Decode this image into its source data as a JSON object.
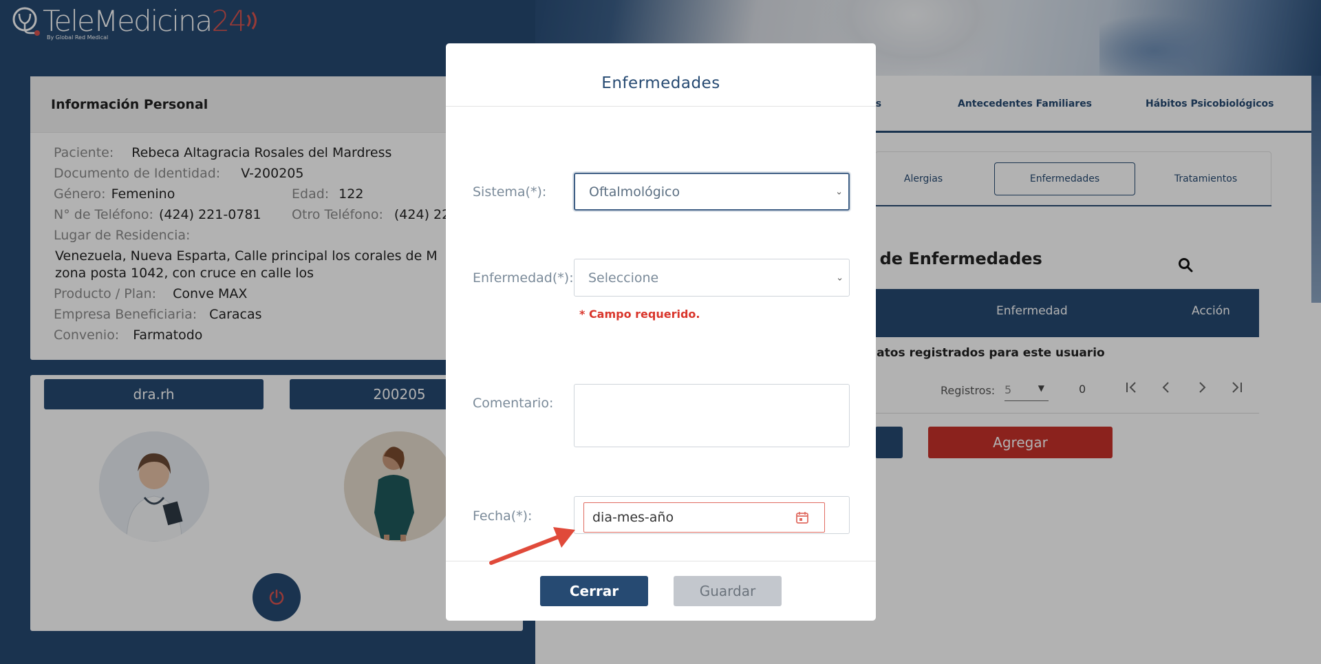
{
  "app": {
    "logo_text": "TeleMedicina",
    "logo_number": "24",
    "logo_byline": "By Global Red Medical"
  },
  "personal_info": {
    "title": "Información Personal",
    "patient_label": "Paciente:",
    "patient_value": "Rebeca Altagracia Rosales del Mardress",
    "id_label": "Documento de Identidad:",
    "id_value": "V-200205",
    "gender_label": "Género:",
    "gender_value": "Femenino",
    "age_label": "Edad:",
    "age_value": "122",
    "phone_label": "N° de Teléfono:",
    "phone_value": "(424) 221-0781",
    "other_phone_label": "Otro Teléfono:",
    "other_phone_value": "(424) 22",
    "residence_label": "Lugar de Residencia:",
    "residence_line1": "Venezuela, Nueva Esparta, Calle principal los corales de M",
    "residence_line2": "zona posta 1042, con cruce en calle los",
    "plan_label": "Producto / Plan:",
    "plan_value": "Conve MAX",
    "company_label": "Empresa Beneficiaria:",
    "company_value": "Caracas",
    "agreement_label": "Convenio:",
    "agreement_value": "Farmatodo"
  },
  "users": {
    "doctor_name": "dra.rh",
    "patient_id": "200205"
  },
  "right_panel": {
    "tabs": [
      "gicos",
      "Antecedentes Familiares",
      "Hábitos Psicobiológicos"
    ],
    "subtabs": [
      "Alergias",
      "Enfermedades",
      "Tratamientos"
    ],
    "active_subtab": "Enfermedades",
    "list_title": "l de Enfermedades",
    "table_headers": [
      "Enfermedad",
      "Acción"
    ],
    "empty_message": "datos registrados para este usuario",
    "pager_label": "Registros:",
    "pager_size": "5",
    "pager_count": "0",
    "add_button": "Agregar"
  },
  "modal": {
    "title": "Enfermedades",
    "system_label": "Sistema(*):",
    "system_value": "Oftalmológico",
    "disease_label": "Enfermedad(*):",
    "disease_placeholder": "Seleccione",
    "required_error": "* Campo requerido.",
    "comment_label": "Comentario:",
    "date_label": "Fecha(*):",
    "date_placeholder": "dia-mes-año",
    "close_button": "Cerrar",
    "save_button": "Guardar"
  },
  "colors": {
    "primary": "#264a72",
    "danger": "#c8312a",
    "error_text": "#d9352b",
    "annotation_arrow": "#e04a3a"
  }
}
